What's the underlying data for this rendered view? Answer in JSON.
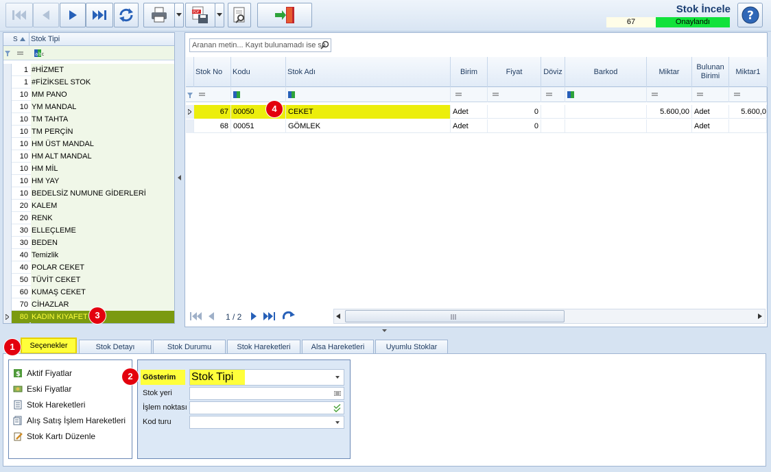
{
  "header": {
    "title": "Stok İncele",
    "record_no": "67",
    "status": "Onaylandı",
    "status_color": "#11e23b"
  },
  "toolbar": {
    "buttons": [
      "first-icon",
      "prev-icon",
      "next-icon",
      "last-icon",
      "refresh-icon",
      "print-icon",
      "pdf-save-icon",
      "properties-icon",
      "exit-door-icon",
      "help-icon"
    ]
  },
  "left_grid": {
    "col_no": "S",
    "col_type": "Stok Tipi",
    "rows": [
      {
        "no": "1",
        "name": "#HİZMET"
      },
      {
        "no": "1",
        "name": "#FİZİKSEL STOK"
      },
      {
        "no": "10",
        "name": "MM PANO"
      },
      {
        "no": "10",
        "name": "YM MANDAL"
      },
      {
        "no": "10",
        "name": "TM TAHTA"
      },
      {
        "no": "10",
        "name": "TM PERÇİN"
      },
      {
        "no": "10",
        "name": "HM ÜST MANDAL"
      },
      {
        "no": "10",
        "name": "HM ALT MANDAL"
      },
      {
        "no": "10",
        "name": "HM MİL"
      },
      {
        "no": "10",
        "name": "HM YAY"
      },
      {
        "no": "10",
        "name": "BEDELSİZ NUMUNE GİDERLERİ"
      },
      {
        "no": "20",
        "name": "KALEM"
      },
      {
        "no": "20",
        "name": "RENK"
      },
      {
        "no": "30",
        "name": "ELLEÇLEME"
      },
      {
        "no": "30",
        "name": "BEDEN"
      },
      {
        "no": "40",
        "name": "Temizlik"
      },
      {
        "no": "40",
        "name": "POLAR CEKET"
      },
      {
        "no": "50",
        "name": "TÜVİT CEKET"
      },
      {
        "no": "60",
        "name": "KUMAŞ CEKET"
      },
      {
        "no": "70",
        "name": "CİHAZLAR"
      },
      {
        "no": "80",
        "name": "KADIN KIYAFET"
      }
    ]
  },
  "search": {
    "placeholder": "Aranan metin... Kayıt bulunamadı ise sa"
  },
  "right_grid": {
    "columns": {
      "stok_no": "Stok No",
      "kodu": "Kodu",
      "stok_adi": "Stok Adı",
      "birim": "Birim",
      "fiyat": "Fiyat",
      "doviz": "Döviz",
      "barkod": "Barkod",
      "miktar": "Miktar",
      "bulunan_birimi": "Bulunan Birimi",
      "miktar1": "Miktar1"
    },
    "rows": [
      {
        "stok_no": "67",
        "kodu": "00050",
        "stok_adi": "CEKET",
        "birim": "Adet",
        "fiyat": "0",
        "doviz": "",
        "barkod": "",
        "miktar": "5.600,00",
        "bulunan_birimi": "Adet",
        "miktar1": "5.600,0"
      },
      {
        "stok_no": "68",
        "kodu": "00051",
        "stok_adi": "GÖMLEK",
        "birim": "Adet",
        "fiyat": "0",
        "doviz": "",
        "barkod": "",
        "miktar": "",
        "bulunan_birimi": "Adet",
        "miktar1": ""
      }
    ]
  },
  "pager": {
    "page": "1 / 2"
  },
  "tabs": [
    "Seçenekler",
    "Stok Detayı",
    "Stok Durumu",
    "Stok Hareketleri",
    "Alsa Hareketleri",
    "Uyumlu Stoklar"
  ],
  "actions": [
    {
      "label": "Aktif Fiyatlar",
      "icon": "price-icon"
    },
    {
      "label": "Eski Fiyatlar",
      "icon": "old-price-icon"
    },
    {
      "label": "Stok Hareketleri",
      "icon": "movements-icon"
    },
    {
      "label": "Alış Satış İşlem Hareketleri",
      "icon": "transactions-icon"
    },
    {
      "label": "Stok Kartı Düzenle",
      "icon": "edit-card-icon"
    }
  ],
  "form": {
    "gosterim_label": "Gösterim",
    "gosterim_value": "Stok Tipi",
    "stok_yeri_label": "Stok yeri",
    "islem_noktasi_label": "İşlem noktası",
    "kod_turu_label": "Kod turu"
  },
  "annotations": [
    "1",
    "2",
    "3",
    "4"
  ],
  "colors": {
    "highlight": "#ecee0c",
    "selected_row": "#7b9a10",
    "badge": "#e3000e"
  }
}
